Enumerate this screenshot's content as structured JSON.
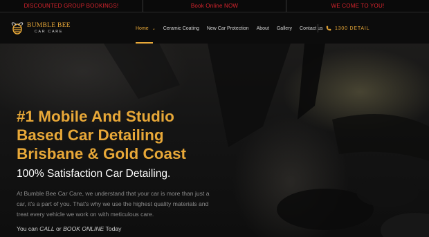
{
  "promo_bar": {
    "items": [
      "DISCOUNTED GROUP BOOKINGS!",
      "Book Online NOW",
      "WE COME TO YOU!"
    ]
  },
  "brand": {
    "name": "BUMBLE BEE",
    "tagline": "CAR CARE",
    "accent_color": "#e8a838"
  },
  "nav": {
    "items": [
      {
        "label": "Home",
        "active": true,
        "has_dropdown": true
      },
      {
        "label": "Ceramic Coating"
      },
      {
        "label": "New Car Protection"
      },
      {
        "label": "About"
      },
      {
        "label": "Gallery"
      },
      {
        "label": "Contact us"
      }
    ],
    "phone_icon": "phone-icon",
    "phone": "1300 DETAIL"
  },
  "hero": {
    "title_lines": [
      "#1 Mobile And Studio",
      "Based Car Detailing",
      "Brisbane & Gold Coast"
    ],
    "subtitle": "100% Satisfaction Car Detailing.",
    "body": "At Bumble Bee Car Care, we understand that your car is more than just a car, it's a part of you. That's why we use the highest quality materials and treat every vehicle we work on with meticulous care.",
    "cta_prefix": "You can ",
    "cta_call": "CALL",
    "cta_or": " or ",
    "cta_book": "BOOK ONLINE",
    "cta_suffix": " Today"
  }
}
